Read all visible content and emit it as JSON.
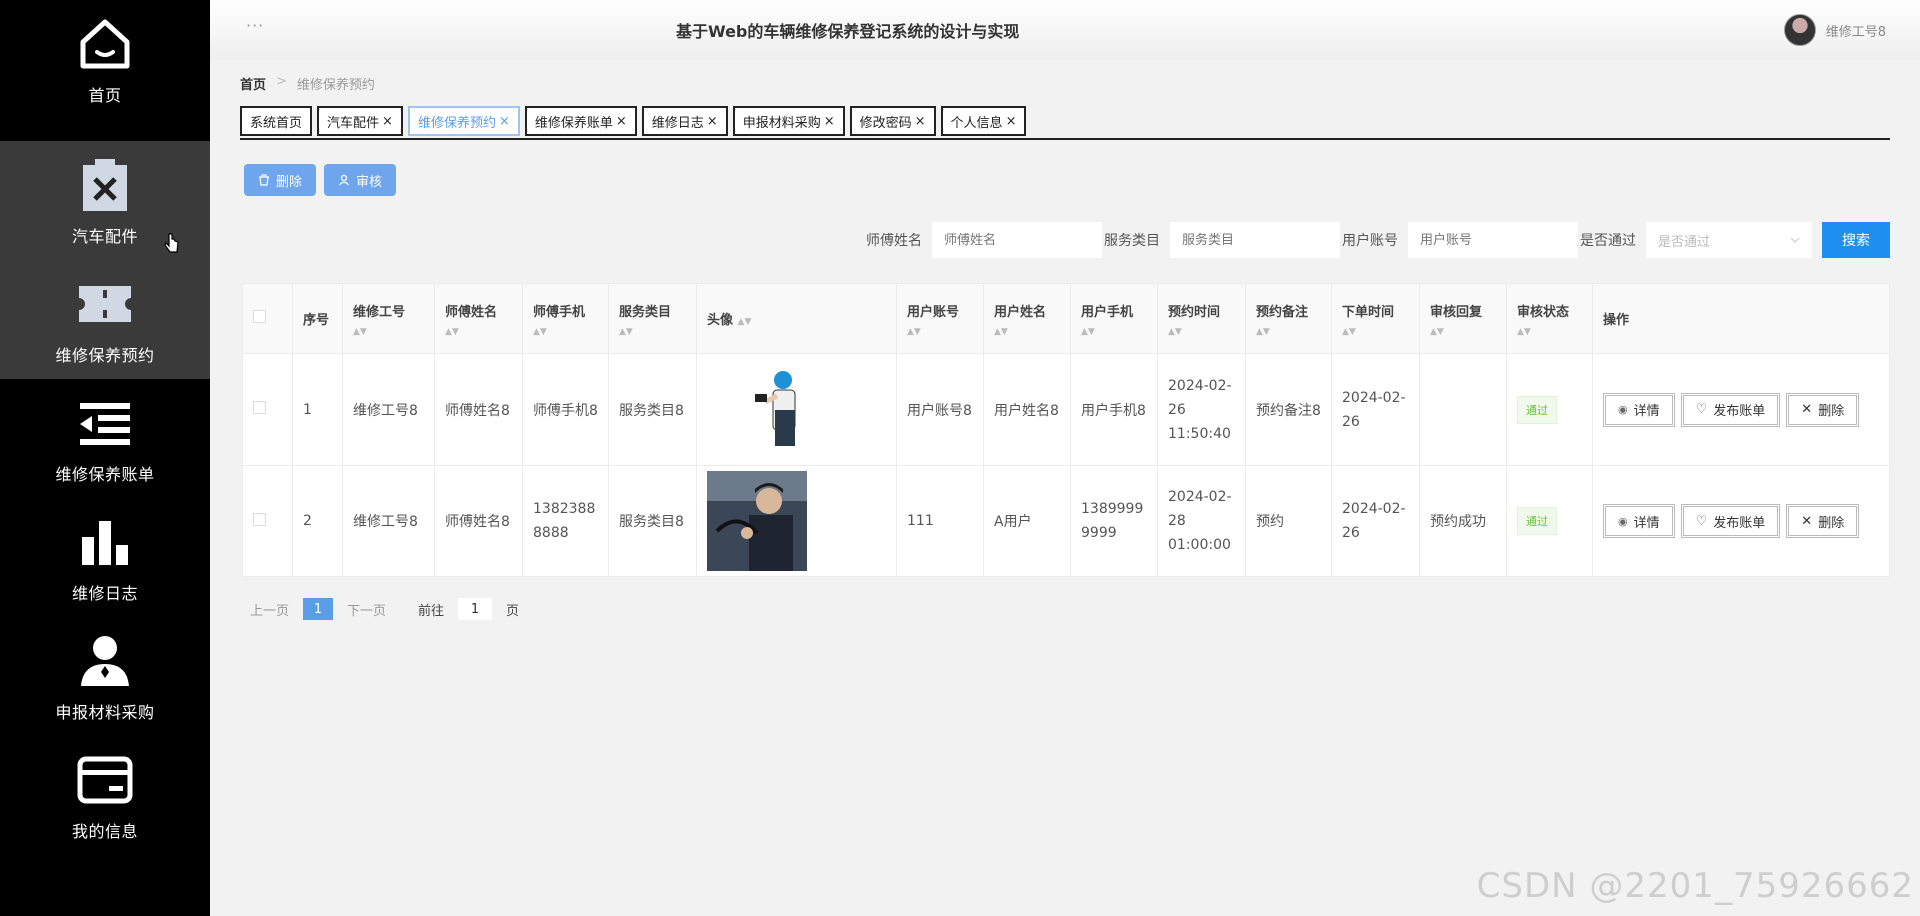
{
  "sidebar": {
    "items": [
      {
        "label": "首页",
        "icon": "home-icon"
      },
      {
        "label": "汽车配件",
        "icon": "clipboard-x-icon"
      },
      {
        "label": "维修保养预约",
        "icon": "ticket-icon"
      },
      {
        "label": "维修保养账单",
        "icon": "list-indent-icon"
      },
      {
        "label": "维修日志",
        "icon": "bar-chart-icon"
      },
      {
        "label": "申报材料采购",
        "icon": "user-icon"
      },
      {
        "label": "我的信息",
        "icon": "card-icon"
      }
    ]
  },
  "header": {
    "dots": "···",
    "title": "基于Web的车辆维修保养登记系统的设计与实现",
    "user": "维修工号8"
  },
  "breadcrumb": {
    "home": "首页",
    "sep": ">",
    "current": "维修保养预约"
  },
  "tabs": [
    {
      "label": "系统首页",
      "closable": ""
    },
    {
      "label": "汽车配件",
      "closable": "×"
    },
    {
      "label": "维修保养预约",
      "closable": "×"
    },
    {
      "label": "维修保养账单",
      "closable": "×"
    },
    {
      "label": "维修日志",
      "closable": "×"
    },
    {
      "label": "申报材料采购",
      "closable": "×"
    },
    {
      "label": "修改密码",
      "closable": "×"
    },
    {
      "label": "个人信息",
      "closable": "×"
    }
  ],
  "actions": {
    "delete": "删除",
    "audit": "审核"
  },
  "search": {
    "fields": [
      {
        "label": "师傅姓名",
        "placeholder": "师傅姓名"
      },
      {
        "label": "服务类目",
        "placeholder": "服务类目"
      },
      {
        "label": "用户账号",
        "placeholder": "用户账号"
      }
    ],
    "pass_label": "是否通过",
    "pass_placeholder": "是否通过",
    "button": "搜索"
  },
  "table": {
    "headers": [
      "序号",
      "维修工号",
      "师傅姓名",
      "师傅手机",
      "服务类目",
      "头像",
      "用户账号",
      "用户姓名",
      "用户手机",
      "预约时间",
      "预约备注",
      "下单时间",
      "审核回复",
      "审核状态",
      "操作"
    ],
    "rows": [
      {
        "no": "1",
        "worker_id": "维修工号8",
        "master_name": "师傅姓名8",
        "master_phone": "师傅手机8",
        "service": "服务类目8",
        "user_account": "用户账号8",
        "user_name": "用户姓名8",
        "user_phone": "用户手机8",
        "appt_time": "2024-02-26 11:50:40",
        "appt_note": "预约备注8",
        "order_time": "2024-02-26",
        "reply": "",
        "status": "通过"
      },
      {
        "no": "2",
        "worker_id": "维修工号8",
        "master_name": "师傅姓名8",
        "master_phone": "13823888888",
        "service": "服务类目8",
        "user_account": "111",
        "user_name": "A用户",
        "user_phone": "13899999999",
        "appt_time": "2024-02-28 01:00:00",
        "appt_note": "预约",
        "order_time": "2024-02-26",
        "reply": "预约成功",
        "status": "通过"
      }
    ],
    "ops": {
      "detail": "详情",
      "bill": "发布账单",
      "delete": "删除"
    }
  },
  "pager": {
    "prev": "上一页",
    "page": "1",
    "next": "下一页",
    "goto": "前往",
    "goto_value": "1",
    "page_unit": "页"
  },
  "watermark": "CSDN @2201_75926662"
}
